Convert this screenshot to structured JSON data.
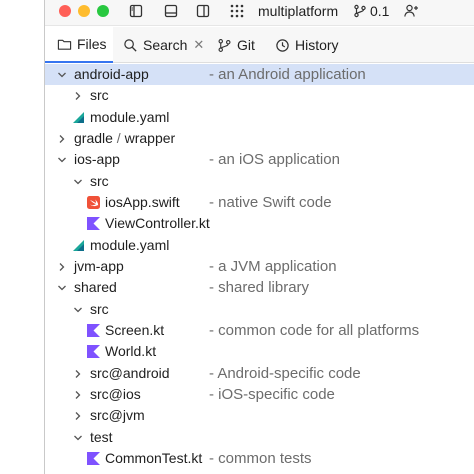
{
  "titlebar": {
    "project_name": "multiplatform",
    "vcs_count": "0.1"
  },
  "tabs": [
    {
      "label": "Files"
    },
    {
      "label": "Search"
    },
    {
      "label": "Git"
    },
    {
      "label": "History"
    }
  ],
  "tree": {
    "rows": [
      {
        "label": "android-app",
        "comment": "- an Android application"
      },
      {
        "label": "src",
        "comment": ""
      },
      {
        "label": "module.yaml",
        "comment": ""
      },
      {
        "label": "gradle",
        "label_sep": " / ",
        "label_2": "wrapper",
        "comment": ""
      },
      {
        "label": "ios-app",
        "comment": "- an iOS application"
      },
      {
        "label": "src",
        "comment": ""
      },
      {
        "label": "iosApp.swift",
        "comment": "- native Swift code"
      },
      {
        "label": "ViewController.kt",
        "comment": ""
      },
      {
        "label": "module.yaml",
        "comment": ""
      },
      {
        "label": "jvm-app",
        "comment": "- a JVM application"
      },
      {
        "label": "shared",
        "comment": "- shared library"
      },
      {
        "label": "src",
        "comment": ""
      },
      {
        "label": "Screen.kt",
        "comment": "- common code for all platforms"
      },
      {
        "label": "World.kt",
        "comment": ""
      },
      {
        "label": "src@android",
        "comment": "- Android-specific code"
      },
      {
        "label": "src@ios",
        "comment": "- iOS-specific code"
      },
      {
        "label": "src@jvm",
        "comment": ""
      },
      {
        "label": "test",
        "comment": ""
      },
      {
        "label": "CommonTest.kt",
        "comment": "- common tests"
      }
    ]
  },
  "colors": {
    "selection": "#d5e1f7",
    "accent": "#3574f0",
    "kotlin": "#7f52ff",
    "amper": "#1aa79a",
    "swift": "#f05138"
  }
}
